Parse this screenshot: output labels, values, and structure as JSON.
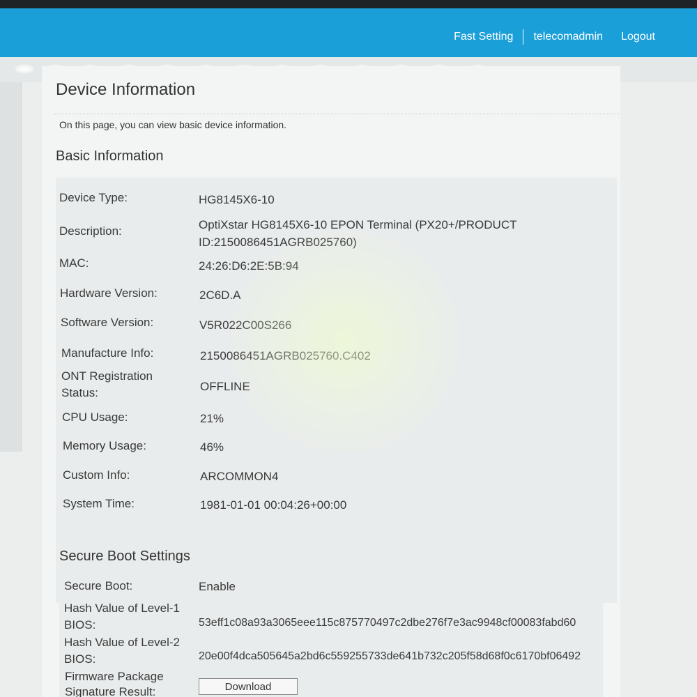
{
  "header": {
    "fast_setting": "Fast Setting",
    "user": "telecomadmin",
    "logout": "Logout"
  },
  "page": {
    "title": "Device Information",
    "description": "On this page, you can view basic device information."
  },
  "basic": {
    "title": "Basic Information",
    "rows": [
      {
        "label": "Device Type:",
        "value": "HG8145X6-10"
      },
      {
        "label": "Description:",
        "value": "OptiXstar HG8145X6-10 EPON Terminal (PX20+/PRODUCT",
        "value2": "ID:2150086451AGRB025760)"
      },
      {
        "label": "MAC:",
        "value": "24:26:D6:2E:5B:94"
      },
      {
        "label": "Hardware Version:",
        "value": "2C6D.A"
      },
      {
        "label": "Software Version:",
        "value": "V5R022C00S266"
      },
      {
        "label": "Manufacture Info:",
        "value": "2150086451AGRB025760.C402"
      },
      {
        "label": "ONT Registration",
        "label2": "Status:",
        "value": "OFFLINE"
      },
      {
        "label": "CPU Usage:",
        "value": "21%"
      },
      {
        "label": "Memory Usage:",
        "value": "46%"
      },
      {
        "label": "Custom Info:",
        "value": "ARCOMMON4"
      },
      {
        "label": "System Time:",
        "value": "1981-01-01 00:04:26+00:00"
      }
    ]
  },
  "secure": {
    "title": "Secure Boot Settings",
    "rows": [
      {
        "label": "Secure Boot:",
        "value": "Enable"
      },
      {
        "label": "Hash Value of Level-1",
        "label2": "BIOS:",
        "value": "53eff1c08a93a3065eee115c875770497c2dbe276f7e3ac9948cf00083fabd60"
      },
      {
        "label": "Hash Value of Level-2",
        "label2": "BIOS:",
        "value": "20e00f4dca505645a2bd6c559255733de641b732c205f58d68f0c6170bf06492"
      },
      {
        "label": "Firmware Package",
        "label2": "Signature Result:",
        "button": "Download"
      }
    ]
  }
}
